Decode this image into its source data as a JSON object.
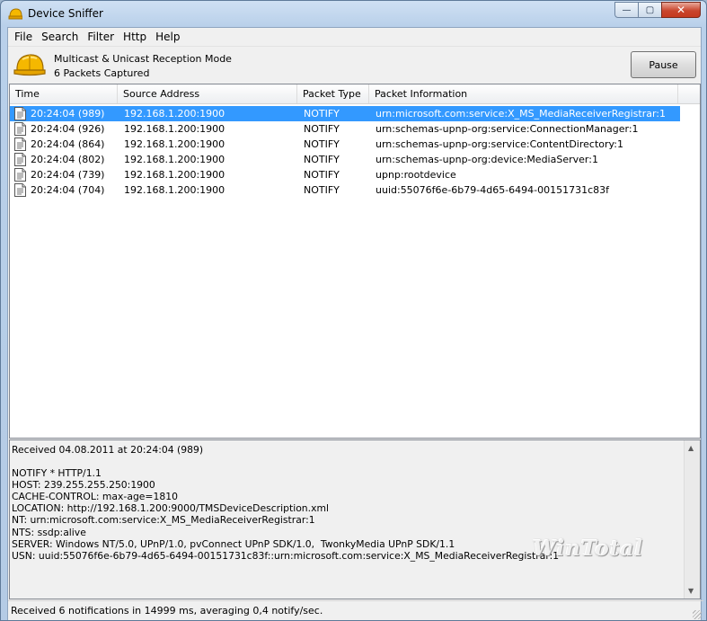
{
  "window": {
    "title": "Device Sniffer",
    "minimize_glyph": "—",
    "maximize_glyph": "▢",
    "close_glyph": "✕"
  },
  "menu": [
    "File",
    "Search",
    "Filter",
    "Http",
    "Help"
  ],
  "status": {
    "mode": "Multicast & Unicast Reception Mode",
    "packets": "6 Packets Captured",
    "pause_label": "Pause"
  },
  "list": {
    "columns": [
      "Time",
      "Source Address",
      "Packet Type",
      "Packet Information"
    ],
    "rows": [
      {
        "time": "20:24:04 (989)",
        "source": "192.168.1.200:1900",
        "type": "NOTIFY",
        "info": "urn:microsoft.com:service:X_MS_MediaReceiverRegistrar:1",
        "selected": true
      },
      {
        "time": "20:24:04 (926)",
        "source": "192.168.1.200:1900",
        "type": "NOTIFY",
        "info": "urn:schemas-upnp-org:service:ConnectionManager:1",
        "selected": false
      },
      {
        "time": "20:24:04 (864)",
        "source": "192.168.1.200:1900",
        "type": "NOTIFY",
        "info": "urn:schemas-upnp-org:service:ContentDirectory:1",
        "selected": false
      },
      {
        "time": "20:24:04 (802)",
        "source": "192.168.1.200:1900",
        "type": "NOTIFY",
        "info": "urn:schemas-upnp-org:device:MediaServer:1",
        "selected": false
      },
      {
        "time": "20:24:04 (739)",
        "source": "192.168.1.200:1900",
        "type": "NOTIFY",
        "info": "upnp:rootdevice",
        "selected": false
      },
      {
        "time": "20:24:04 (704)",
        "source": "192.168.1.200:1900",
        "type": "NOTIFY",
        "info": "uuid:55076f6e-6b79-4d65-6494-00151731c83f",
        "selected": false
      }
    ]
  },
  "detail": {
    "lines": [
      "Received 04.08.2011 at 20:24:04 (989)",
      "",
      "NOTIFY * HTTP/1.1",
      "HOST: 239.255.255.250:1900",
      "CACHE-CONTROL: max-age=1810",
      "LOCATION: http://192.168.1.200:9000/TMSDeviceDescription.xml",
      "NT: urn:microsoft.com:service:X_MS_MediaReceiverRegistrar:1",
      "NTS: ssdp:alive",
      "SERVER: Windows NT/5.0, UPnP/1.0, pvConnect UPnP SDK/1.0,  TwonkyMedia UPnP SDK/1.1",
      "USN: uuid:55076f6e-6b79-4d65-6494-00151731c83f::urn:microsoft.com:service:X_MS_MediaReceiverRegistrar:1"
    ],
    "watermark": "WinTotal"
  },
  "statusbar": {
    "text": "Received 6 notifications in 14999 ms, averaging 0,4 notify/sec."
  },
  "colors": {
    "selection": "#3399ff",
    "helmet": "#f5b800"
  },
  "icons": {
    "app": "helmet-icon",
    "row": "document-icon"
  }
}
